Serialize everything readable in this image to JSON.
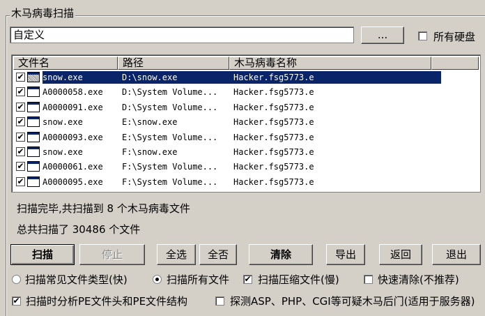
{
  "group_title": "木马病毒扫描",
  "path": {
    "value": "自定义",
    "browse_label": "..."
  },
  "all_disks_label": "所有硬盘",
  "all_disks_checked": false,
  "columns": [
    "文件名",
    "路径",
    "木马病毒名称"
  ],
  "rows": [
    {
      "name": "snow.exe",
      "path": "D:\\snow.exe",
      "virus": "Hacker.fsg5773.e",
      "checked": true,
      "selected": true
    },
    {
      "name": "A0000058.exe",
      "path": "D:\\System Volume...",
      "virus": "Hacker.fsg5773.e",
      "checked": true,
      "selected": false
    },
    {
      "name": "A0000091.exe",
      "path": "D:\\System Volume...",
      "virus": "Hacker.fsg5773.e",
      "checked": true,
      "selected": false
    },
    {
      "name": "snow.exe",
      "path": "E:\\snow.exe",
      "virus": "Hacker.fsg5773.e",
      "checked": true,
      "selected": false
    },
    {
      "name": "A0000093.exe",
      "path": "E:\\System Volume...",
      "virus": "Hacker.fsg5773.e",
      "checked": true,
      "selected": false
    },
    {
      "name": "snow.exe",
      "path": "F:\\snow.exe",
      "virus": "Hacker.fsg5773.e",
      "checked": true,
      "selected": false
    },
    {
      "name": "A0000061.exe",
      "path": "F:\\System Volume...",
      "virus": "Hacker.fsg5773.e",
      "checked": true,
      "selected": false
    },
    {
      "name": "A0000095.exe",
      "path": "F:\\System Volume...",
      "virus": "Hacker.fsg5773.e",
      "checked": true,
      "selected": false
    }
  ],
  "status": {
    "line1": "扫描完毕,共扫描到 8 个木马病毒文件",
    "line2": "总共扫描了 30486 个文件"
  },
  "buttons": {
    "scan": "扫描",
    "stop": "停止",
    "select_all": "全选",
    "select_none": "全否",
    "clean": "清除",
    "export": "导出",
    "back": "返回",
    "exit": "退出"
  },
  "options": {
    "common_types": "扫描常见文件类型(快)",
    "common_types_checked": false,
    "all_files": "扫描所有文件",
    "all_files_checked": true,
    "compressed": "扫描压缩文件(慢)",
    "compressed_checked": true,
    "quick_clean": "快速清除(不推荐)",
    "quick_clean_checked": false,
    "pe_analysis": "扫描时分析PE文件头和PE文件结构",
    "pe_analysis_checked": true,
    "backdoor": "探测ASP、PHP、CGI等可疑木马后门(适用于服务器)",
    "backdoor_checked": false
  }
}
